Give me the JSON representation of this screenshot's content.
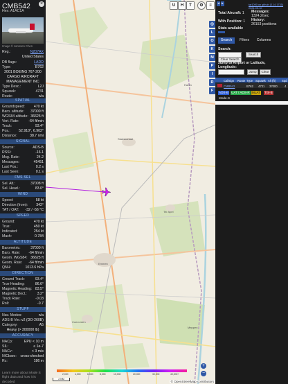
{
  "aircraft": {
    "callsign": "CMB542",
    "hex_line": "Hex: A1AC1A",
    "photo_caption": "Image © Jannsen Chen",
    "registration": {
      "label": "Reg.:",
      "value": "N207AX"
    },
    "country": "United States",
    "db_flags": {
      "label": "DB flags:",
      "value": "LADD"
    },
    "type": {
      "label": "Type:",
      "value": "B762"
    },
    "type_full": "2001 BOEING 767-200",
    "operator": "CARGO AIRCRAFT MANAGEMENT INC",
    "type_desc": {
      "label": "Type Desc.:",
      "value": "L2J"
    },
    "squawk": {
      "label": "Squawk:",
      "value": "4731"
    },
    "route": {
      "label": "Route:",
      "value": "n/a"
    }
  },
  "sections": {
    "spatial": {
      "title": "SPATIAL",
      "rows": [
        {
          "k": "Groundspeed:",
          "v": "470 kt"
        },
        {
          "k": "Baro. altitude:",
          "v": "37000 ft"
        },
        {
          "k": "WGS84 altitude:",
          "v": "36625 ft"
        },
        {
          "k": "Vert. Rate:",
          "v": "-64 ft/min"
        },
        {
          "k": "Track:",
          "v": "93.4°"
        },
        {
          "k": "Pos.:",
          "v": "52.910°, 6.902°"
        },
        {
          "k": "Distance:",
          "v": "38.7 nmi"
        }
      ]
    },
    "signal": {
      "title": "SIGNAL",
      "rows": [
        {
          "k": "Source:",
          "v": "ADS-B"
        },
        {
          "k": "RSSI:",
          "v": "-16.1"
        },
        {
          "k": "Msg. Rate:",
          "v": "24.2"
        },
        {
          "k": "Messages:",
          "v": "45451"
        },
        {
          "k": "Last Pos.:",
          "v": "0.2 s"
        },
        {
          "k": "Last Seen:",
          "v": "0.1 s"
        }
      ]
    },
    "fms_sel": {
      "title": "FMS SEL",
      "rows": [
        {
          "k": "Sel. Alt.:",
          "v": "37008 ft"
        },
        {
          "k": "Sel. Head.:",
          "v": "83.0°"
        }
      ]
    },
    "wind": {
      "title": "WIND",
      "rows": [
        {
          "k": "Speed:",
          "v": "58 kt"
        },
        {
          "k": "Direction (from):",
          "v": "342°"
        },
        {
          "k": "TAT / OAT:",
          "v": "-32 / -56 °C"
        }
      ]
    },
    "speed": {
      "title": "SPEED",
      "rows": [
        {
          "k": "Ground:",
          "v": "470 kt"
        },
        {
          "k": "True:",
          "v": "450 kt"
        },
        {
          "k": "Indicated:",
          "v": "254 kt"
        },
        {
          "k": "Mach:",
          "v": "0.784"
        }
      ]
    },
    "altitude": {
      "title": "ALTITUDE",
      "rows": [
        {
          "k": "Barometric:",
          "v": "37000 ft"
        },
        {
          "k": "Baro. Rate:",
          "v": "-64 ft/min"
        },
        {
          "k": "Geom. WGS84:",
          "v": "36625 ft"
        },
        {
          "k": "Geom. Rate:",
          "v": "-64 ft/min"
        },
        {
          "k": "QNH:",
          "v": "1013.6 hPa"
        }
      ]
    },
    "direction": {
      "title": "DIRECTION",
      "rows": [
        {
          "k": "Ground Track:",
          "v": "93.4°"
        },
        {
          "k": "True Heading:",
          "v": "86.6°"
        },
        {
          "k": "Magnetic Heading:",
          "v": "83.5°"
        },
        {
          "k": "Magnetic Decl.:",
          "v": "3.2°"
        },
        {
          "k": "Track Rate:",
          "v": "-0.03"
        },
        {
          "k": "Roll:",
          "v": "-0.7"
        }
      ]
    },
    "stuff": {
      "title": "STUFF",
      "rows": [
        {
          "k": "Nav. Modes:",
          "v": "n/a"
        },
        {
          "k": "ADS-B Ver.:",
          "v": "v2 (DO-260B)"
        },
        {
          "k": "Category:",
          "v": "A5"
        }
      ],
      "category_desc": "Heavy (> 300000 lb)"
    },
    "accuracy": {
      "title": "ACCURACY",
      "rows": [
        {
          "k": "NACp:",
          "v": "EPU < 10 m"
        },
        {
          "k": "SIL:",
          "v": "≤ 1e-7"
        },
        {
          "k": "NACv:",
          "v": "< 3 m/s"
        },
        {
          "k": "NICbaro:",
          "v": "cross-checked"
        },
        {
          "k": "Rc:",
          "v": "186 m"
        }
      ]
    }
  },
  "panel_footer": "Learn more about Mode S flight data and how it is decoded",
  "map": {
    "buttons": [
      "U",
      "H",
      "T"
    ],
    "side_buttons": [
      "L",
      "O",
      "K",
      "M",
      "P",
      "I",
      "R"
    ],
    "zoom_in": "+",
    "zoom_out": "−",
    "colorbar_labels": [
      "2,000",
      "4,000",
      "6,000",
      "8,000",
      "10,000",
      "20,000",
      "30,000",
      "40,000+"
    ],
    "scale": "2 NM",
    "attribution": "© OpenStreetMap contributors",
    "towns": [
      "Stadskanaal",
      "Emmen",
      "Coevorden",
      "Ter Apel",
      "Haren",
      "Meppen"
    ]
  },
  "sidebar": {
    "header_link": "tar1090 on github (3.14.1735)",
    "header_date": "2024-05-10",
    "total_aircraft": {
      "label": "Total Aircraft:",
      "value": "1"
    },
    "messages": {
      "label": "Messages:",
      "value": "1324.2/sec"
    },
    "with_position": {
      "label": "With Position:",
      "value": "1"
    },
    "history": {
      "label": "History:",
      "value": "26153 positions"
    },
    "stats": "Stats available",
    "tabs": [
      "Search",
      "Filters",
      "Columns"
    ],
    "search_label": "Search:",
    "search_button": "Search",
    "clear_search": "Clear Search",
    "jump_label": "Jump to Airport or Latitude, Longitude:",
    "jump_button": "Jump",
    "clear_button": "Clear",
    "table_headers": [
      "Callsign",
      "Route",
      "Type",
      "Squawk",
      "Alt (ft)",
      "Spd"
    ],
    "table_row": {
      "callsign": "CMB542",
      "type": "B762",
      "squawk": "4731",
      "alt": "37000",
      "spd": "4"
    },
    "legend": [
      "ADS-B",
      "UAT / ADS-R",
      "MLAT",
      "TIS-B"
    ],
    "legend_colors": [
      "#2c5cd4",
      "#2aa84a",
      "#c7a30a",
      "#b03030"
    ],
    "mode_s": "Mode-S"
  }
}
